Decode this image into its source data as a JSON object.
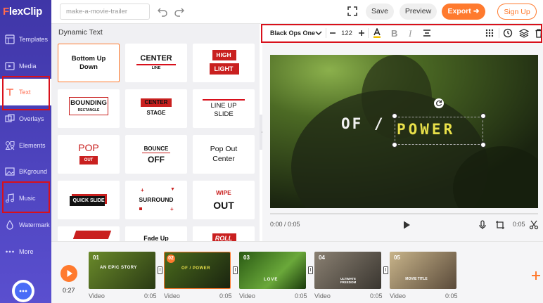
{
  "app": {
    "logo_text_a": "F",
    "logo_text_b": "lexClip",
    "project_name": "make-a-movie-trailer"
  },
  "sidebar": {
    "items": [
      {
        "label": "Templates",
        "icon": "templates-icon"
      },
      {
        "label": "Media",
        "icon": "media-icon"
      },
      {
        "label": "Text",
        "icon": "text-icon",
        "active": true
      },
      {
        "label": "Overlays",
        "icon": "overlays-icon"
      },
      {
        "label": "Elements",
        "icon": "elements-icon"
      },
      {
        "label": "BKground",
        "icon": "background-icon"
      },
      {
        "label": "Music",
        "icon": "music-icon"
      },
      {
        "label": "Watermark",
        "icon": "watermark-icon"
      },
      {
        "label": "More",
        "icon": "more-icon"
      }
    ]
  },
  "topbar": {
    "save": "Save",
    "preview": "Preview",
    "export": "Export",
    "signup": "Sign Up"
  },
  "panel": {
    "title": "Dynamic Text",
    "cards": [
      {
        "lines": [
          "Bottom Up",
          "Down"
        ]
      },
      {
        "lines": [
          "CENTER",
          "LINE"
        ]
      },
      {
        "lines": [
          "HIGH",
          "LIGHT"
        ]
      },
      {
        "lines": [
          "BOUNDING",
          "RECTANGLE"
        ]
      },
      {
        "lines": [
          "CENTER",
          "STAGE"
        ]
      },
      {
        "lines": [
          "LINE UP",
          "SLIDE"
        ]
      },
      {
        "lines": [
          "POP",
          "OUT"
        ]
      },
      {
        "lines": [
          "BOUNCE",
          "OFF"
        ]
      },
      {
        "lines": [
          "Pop Out",
          "Center"
        ]
      },
      {
        "lines": [
          "QUICK SLIDE"
        ]
      },
      {
        "lines": [
          "SURROUND"
        ]
      },
      {
        "lines": [
          "WIPE",
          "OUT"
        ]
      },
      {
        "lines": [
          ""
        ]
      },
      {
        "lines": [
          "Fade Up"
        ]
      },
      {
        "lines": [
          "ROLL"
        ]
      }
    ]
  },
  "text_toolbar": {
    "font": "Black Ops One",
    "size": "122"
  },
  "preview": {
    "text_left": "OF /",
    "text_right": "POWER",
    "time_current": "0:00 / 0:05",
    "time_right": "0:05"
  },
  "timeline": {
    "total": "0:27",
    "clips": [
      {
        "num": "01",
        "type": "Video",
        "dur": "0:05",
        "caption": "AN EPIC STORY",
        "bg": "#3a4a1c"
      },
      {
        "num": "02",
        "type": "Video",
        "dur": "0:05",
        "caption": "OF / POWER",
        "bg": "#2a3a18",
        "selected": true
      },
      {
        "num": "03",
        "type": "Video",
        "dur": "0:05",
        "caption": "LOVE",
        "bg": "#2c5a1a"
      },
      {
        "num": "04",
        "type": "Video",
        "dur": "0:05",
        "caption": "ULTIMATE FREEDOM",
        "bg": "#5a5048"
      },
      {
        "num": "05",
        "type": "Video",
        "dur": "0:05",
        "caption": "MOVIE TITLE",
        "bg": "#8a7a62"
      }
    ]
  },
  "colors": {
    "accent": "#ff7a2e",
    "sidebar": "#4f45c0",
    "highlight_box": "#d8101b",
    "title_yellow": "#e8e04a"
  }
}
